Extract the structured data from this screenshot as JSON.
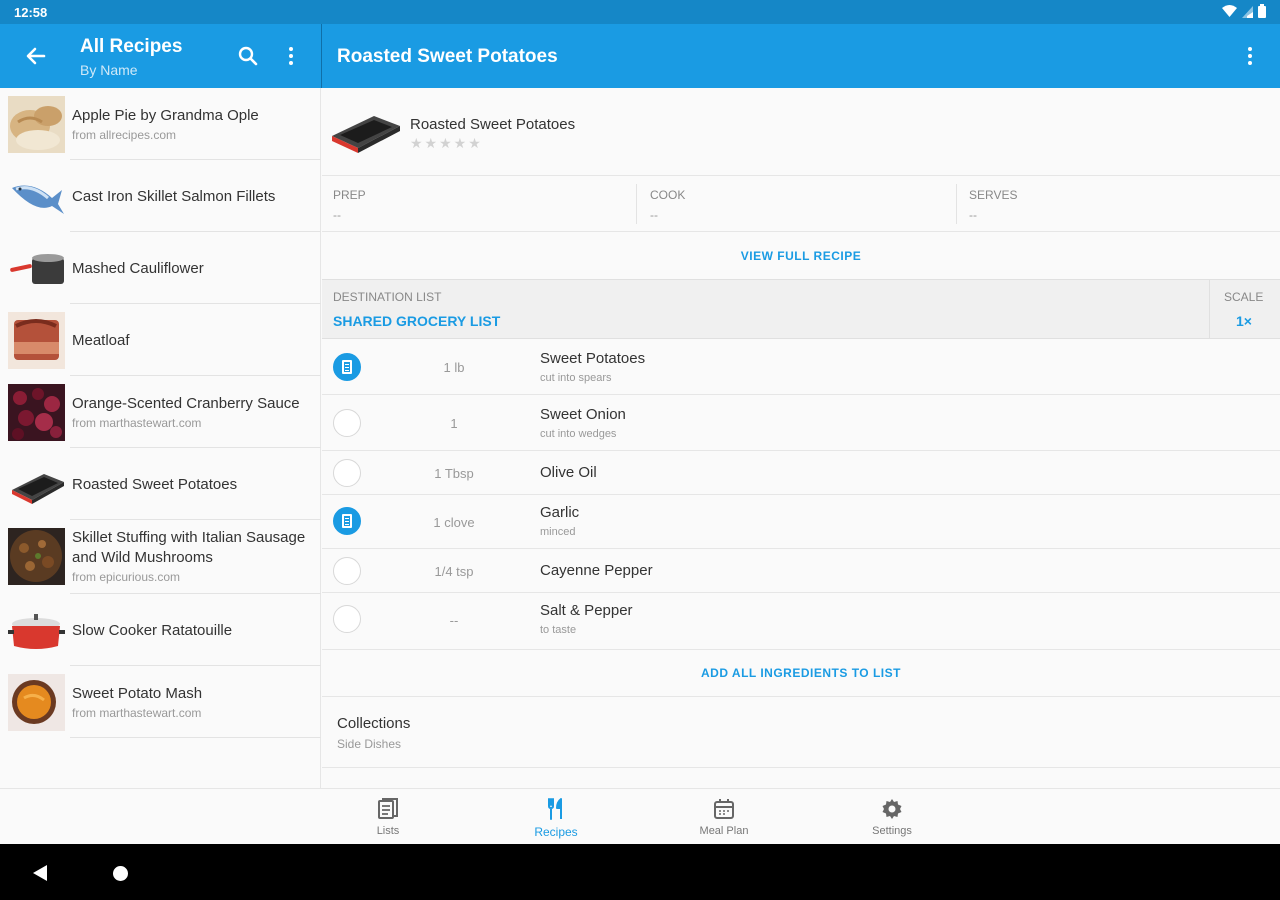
{
  "status_bar": {
    "time": "12:58"
  },
  "left_header": {
    "title": "All Recipes",
    "subtitle": "By Name"
  },
  "right_header": {
    "title": "Roasted Sweet Potatoes"
  },
  "recipes": [
    {
      "title": "Apple Pie by Grandma Ople",
      "source": "from allrecipes.com",
      "thumb": "apple-pie"
    },
    {
      "title": "Cast Iron Skillet Salmon Fillets",
      "source": "",
      "thumb": "salmon"
    },
    {
      "title": "Mashed Cauliflower",
      "source": "",
      "thumb": "saucepan"
    },
    {
      "title": "Meatloaf",
      "source": "",
      "thumb": "meatloaf"
    },
    {
      "title": "Orange-Scented Cranberry Sauce",
      "source": "from marthastewart.com",
      "thumb": "cranberry"
    },
    {
      "title": "Roasted Sweet Potatoes",
      "source": "",
      "thumb": "baking-dish"
    },
    {
      "title": "Skillet Stuffing with Italian Sausage and Wild Mushrooms",
      "source": "from epicurious.com",
      "thumb": "stuffing"
    },
    {
      "title": "Slow Cooker Ratatouille",
      "source": "",
      "thumb": "slow-cooker"
    },
    {
      "title": "Sweet Potato Mash",
      "source": "from marthastewart.com",
      "thumb": "sweet-potato-mash"
    }
  ],
  "detail": {
    "title": "Roasted Sweet Potatoes",
    "rating": 0,
    "stars": "★★★★★",
    "stats": [
      {
        "label": "PREP",
        "value": "--"
      },
      {
        "label": "COOK",
        "value": "--"
      },
      {
        "label": "SERVES",
        "value": "--"
      }
    ],
    "view_full_recipe": "VIEW FULL RECIPE",
    "destination_label": "DESTINATION LIST",
    "destination_value": "SHARED GROCERY LIST",
    "scale_label": "SCALE",
    "scale_value": "1×",
    "ingredients": [
      {
        "checked": true,
        "qty": "1 lb",
        "name": "Sweet Potatoes",
        "note": "cut into spears"
      },
      {
        "checked": false,
        "qty": "1",
        "name": "Sweet Onion",
        "note": "cut into wedges"
      },
      {
        "checked": false,
        "qty": "1 Tbsp",
        "name": "Olive Oil",
        "note": ""
      },
      {
        "checked": true,
        "qty": "1 clove",
        "name": "Garlic",
        "note": "minced"
      },
      {
        "checked": false,
        "qty": "1/4 tsp",
        "name": "Cayenne Pepper",
        "note": ""
      },
      {
        "checked": false,
        "qty": "--",
        "name": "Salt & Pepper",
        "note": "to taste"
      }
    ],
    "add_all": "ADD ALL INGREDIENTS TO LIST",
    "collections_label": "Collections",
    "collections_value": "Side Dishes"
  },
  "bottom_nav": [
    {
      "label": "Lists",
      "icon": "lists-icon",
      "active": false
    },
    {
      "label": "Recipes",
      "icon": "utensils-icon",
      "active": true
    },
    {
      "label": "Meal Plan",
      "icon": "calendar-icon",
      "active": false
    },
    {
      "label": "Settings",
      "icon": "gear-icon",
      "active": false
    }
  ],
  "colors": {
    "accent": "#1a9be3",
    "status_bar": "#1587c7"
  }
}
